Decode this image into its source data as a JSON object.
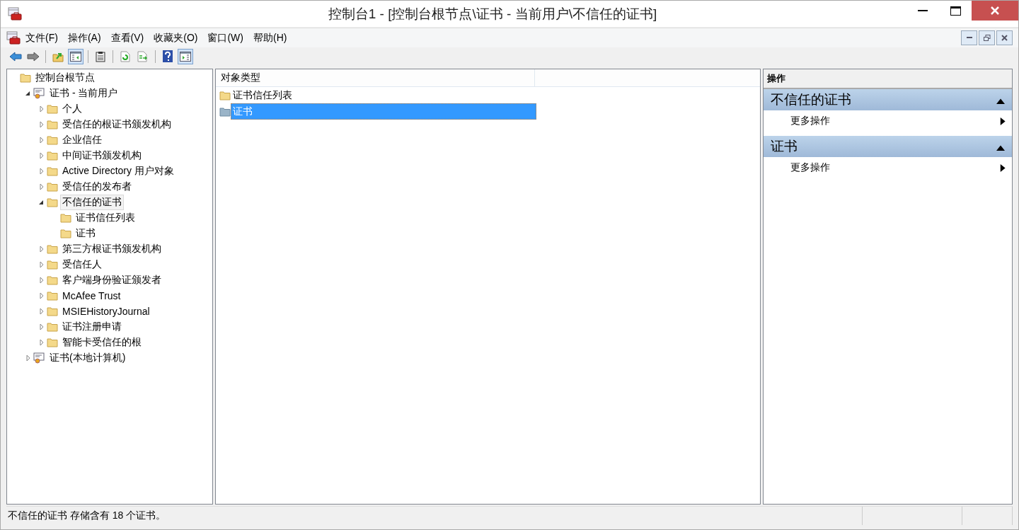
{
  "window": {
    "title": "控制台1 - [控制台根节点\\证书 - 当前用户\\不信任的证书]",
    "controls": [
      {
        "kind": "minimize"
      },
      {
        "kind": "maximize"
      },
      {
        "kind": "close"
      }
    ]
  },
  "menu": {
    "items": [
      "文件(F)",
      "操作(A)",
      "查看(V)",
      "收藏夹(O)",
      "窗口(W)",
      "帮助(H)"
    ],
    "controls": [
      {
        "kind": "minimize"
      },
      {
        "kind": "restore"
      },
      {
        "kind": "close"
      }
    ]
  },
  "toolbar": [
    {
      "kind": "back",
      "pressed": false
    },
    {
      "kind": "forward",
      "pressed": false
    },
    {
      "kind": "separator"
    },
    {
      "kind": "up",
      "pressed": false
    },
    {
      "kind": "tree",
      "pressed": true
    },
    {
      "kind": "separator"
    },
    {
      "kind": "clipboard",
      "pressed": false
    },
    {
      "kind": "separator"
    },
    {
      "kind": "refresh",
      "pressed": false
    },
    {
      "kind": "export",
      "pressed": false
    },
    {
      "kind": "separator"
    },
    {
      "kind": "help",
      "pressed": false
    },
    {
      "kind": "actionpane",
      "pressed": true
    }
  ],
  "tree": [
    {
      "label": "控制台根节点",
      "kind": "folder",
      "expandable": false,
      "selected": false,
      "children": [
        {
          "label": "证书 - 当前用户",
          "kind": "certificate",
          "expandable": true,
          "expanded": true,
          "selected": false,
          "children": [
            {
              "label": "个人",
              "kind": "folder",
              "expandable": true,
              "expanded": false,
              "selected": false
            },
            {
              "label": "受信任的根证书颁发机构",
              "kind": "folder",
              "expandable": true,
              "expanded": false,
              "selected": false
            },
            {
              "label": "企业信任",
              "kind": "folder",
              "expandable": true,
              "expanded": false,
              "selected": false
            },
            {
              "label": "中间证书颁发机构",
              "kind": "folder",
              "expandable": true,
              "expanded": false,
              "selected": false
            },
            {
              "label": "Active Directory 用户对象",
              "kind": "folder",
              "expandable": true,
              "expanded": false,
              "selected": false
            },
            {
              "label": "受信任的发布者",
              "kind": "folder",
              "expandable": true,
              "expanded": false,
              "selected": false
            },
            {
              "label": "不信任的证书",
              "kind": "folder",
              "expandable": true,
              "expanded": true,
              "selected": true,
              "children": [
                {
                  "label": "证书信任列表",
                  "kind": "folder",
                  "expandable": false,
                  "selected": false
                },
                {
                  "label": "证书",
                  "kind": "folder",
                  "expandable": false,
                  "selected": false
                }
              ]
            },
            {
              "label": "第三方根证书颁发机构",
              "kind": "folder",
              "expandable": true,
              "expanded": false,
              "selected": false
            },
            {
              "label": "受信任人",
              "kind": "folder",
              "expandable": true,
              "expanded": false,
              "selected": false
            },
            {
              "label": "客户端身份验证颁发者",
              "kind": "folder",
              "expandable": true,
              "expanded": false,
              "selected": false
            },
            {
              "label": "McAfee Trust",
              "kind": "folder",
              "expandable": true,
              "expanded": false,
              "selected": false
            },
            {
              "label": "MSIEHistoryJournal",
              "kind": "folder",
              "expandable": true,
              "expanded": false,
              "selected": false
            },
            {
              "label": "证书注册申请",
              "kind": "folder",
              "expandable": true,
              "expanded": false,
              "selected": false
            },
            {
              "label": "智能卡受信任的根",
              "kind": "folder",
              "expandable": true,
              "expanded": false,
              "selected": false
            }
          ]
        },
        {
          "label": "证书(本地计算机)",
          "kind": "certificate",
          "expandable": true,
          "expanded": false,
          "selected": false
        }
      ]
    }
  ],
  "list": {
    "columns": [
      "对象类型"
    ],
    "rows": [
      {
        "name": "证书信任列表",
        "selected": false
      },
      {
        "name": "证书",
        "selected": true
      }
    ]
  },
  "actions": {
    "title": "操作",
    "sections": [
      {
        "title": "不信任的证书",
        "expanded": true,
        "items": [
          "更多操作"
        ]
      },
      {
        "title": "证书",
        "expanded": true,
        "items": [
          "更多操作"
        ]
      }
    ]
  },
  "status_bar": {
    "text": "不信任的证书 存储含有 18 个证书。"
  }
}
